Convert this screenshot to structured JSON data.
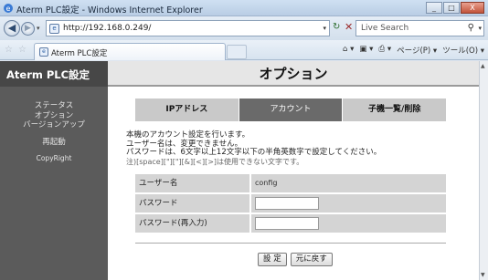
{
  "window": {
    "title": "Aterm PLC設定 - Windows Internet Explorer",
    "minimize": "_",
    "maximize": "□",
    "close": "X"
  },
  "addressbar": {
    "url": "http://192.168.0.249/",
    "search_placeholder": "Live Search"
  },
  "tabbar": {
    "tab_title": "Aterm PLC設定",
    "page_menu": "ページ(P) ▾",
    "tools_menu": "ツール(O) ▾"
  },
  "sidebar": {
    "brand": "Aterm PLC設定",
    "items": [
      "ステータス",
      "オプション",
      "バージョンアップ",
      "再起動",
      "CopyRight"
    ]
  },
  "main": {
    "header": "オプション",
    "tabs": [
      "IPアドレス",
      "アカウント",
      "子機一覧/削除"
    ],
    "active_tab": "アカウント",
    "description": [
      "本機のアカウント設定を行います。",
      "ユーザー名は、変更できません。",
      "パスワードは、6文字以上12文字以下の半角英数字で設定してください。",
      "注)[space][\"][\"][&][<][>]は使用できない文字です。"
    ],
    "form": {
      "username_label": "ユーザー名",
      "username_value": "config",
      "password_label": "パスワード",
      "password_confirm_label": "パスワード(再入力)"
    },
    "buttons": {
      "set": "設 定",
      "reset": "元に戻す"
    }
  },
  "colors": {
    "sidebar_bg": "#5b5b5b",
    "active_tab": "#6a6a6a",
    "inactive_tab": "#c9c9c9",
    "form_row": "#d4d4d4"
  }
}
